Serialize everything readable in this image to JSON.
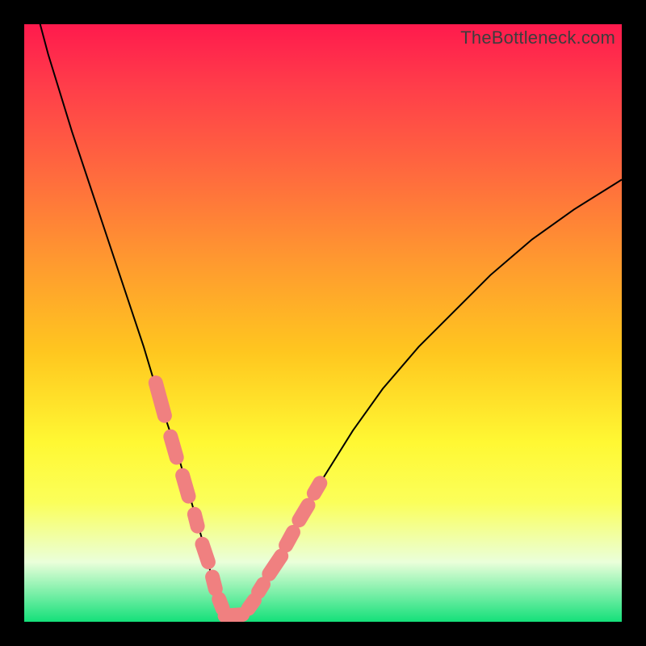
{
  "watermark": "TheBottleneck.com",
  "chart_data": {
    "type": "line",
    "title": "",
    "xlabel": "",
    "ylabel": "",
    "xlim": [
      0,
      100
    ],
    "ylim": [
      0,
      100
    ],
    "grid": false,
    "legend": false,
    "series": [
      {
        "name": "bottleneck-curve",
        "x": [
          0,
          4,
          8,
          12,
          16,
          20,
          23,
          26,
          28,
          30,
          31,
          32,
          33,
          34,
          36,
          38,
          40,
          43,
          46,
          50,
          55,
          60,
          66,
          72,
          78,
          85,
          92,
          100
        ],
        "values": [
          110,
          95,
          82,
          70,
          58,
          46,
          36,
          27,
          20,
          13,
          9,
          5,
          2,
          1,
          1,
          3,
          6,
          11,
          17,
          24,
          32,
          39,
          46,
          52,
          58,
          64,
          69,
          74
        ]
      }
    ],
    "markers": {
      "name": "salmon-segments",
      "color": "#f08080",
      "segments": [
        {
          "x": [
            22.0,
            23.5
          ],
          "y": [
            40.0,
            34.5
          ]
        },
        {
          "x": [
            24.5,
            25.5
          ],
          "y": [
            31.0,
            27.5
          ]
        },
        {
          "x": [
            26.5,
            27.5
          ],
          "y": [
            24.5,
            21.0
          ]
        },
        {
          "x": [
            28.5,
            29.0
          ],
          "y": [
            18.0,
            16.0
          ]
        },
        {
          "x": [
            29.8,
            30.8
          ],
          "y": [
            13.0,
            10.0
          ]
        },
        {
          "x": [
            31.5,
            32.0
          ],
          "y": [
            7.5,
            5.5
          ]
        },
        {
          "x": [
            32.6,
            33.2
          ],
          "y": [
            3.8,
            2.2
          ]
        },
        {
          "x": [
            33.6,
            36.5
          ],
          "y": [
            1.0,
            1.2
          ]
        },
        {
          "x": [
            37.5,
            38.5
          ],
          "y": [
            2.2,
            3.6
          ]
        },
        {
          "x": [
            39.2,
            40.0
          ],
          "y": [
            5.0,
            6.3
          ]
        },
        {
          "x": [
            41.0,
            43.0
          ],
          "y": [
            8.0,
            11.0
          ]
        },
        {
          "x": [
            43.8,
            45.0
          ],
          "y": [
            12.8,
            15.0
          ]
        },
        {
          "x": [
            46.0,
            47.5
          ],
          "y": [
            17.0,
            19.5
          ]
        },
        {
          "x": [
            48.5,
            49.5
          ],
          "y": [
            21.5,
            23.2
          ]
        }
      ]
    },
    "background_gradient": {
      "top": "#ff1a4d",
      "upper_mid": "#ff9a2f",
      "mid": "#fff833",
      "lower_mid": "#eaffda",
      "bottom": "#14e07a"
    }
  }
}
